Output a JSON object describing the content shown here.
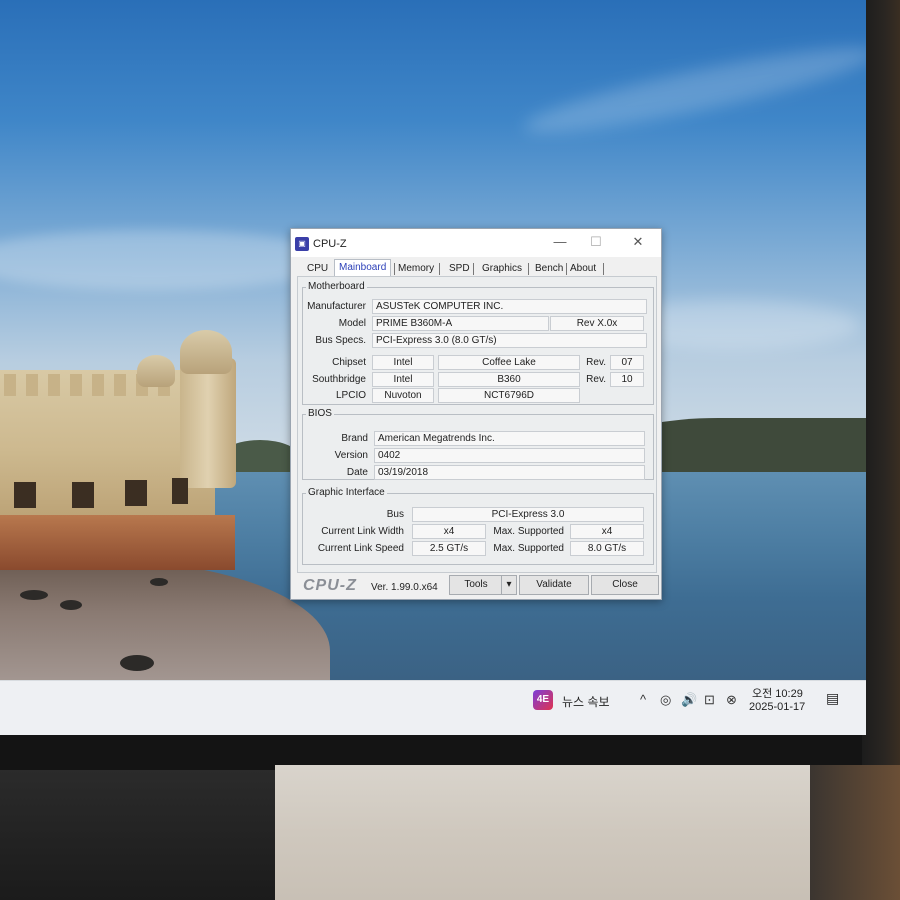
{
  "window": {
    "title": "CPU-Z",
    "app_icon": "cpuz-icon",
    "minimize": "—",
    "maximize": "☐",
    "close": "✕"
  },
  "tabs": [
    "CPU",
    "Mainboard",
    "Memory",
    "SPD",
    "Graphics",
    "Bench",
    "About"
  ],
  "active_tab": "Mainboard",
  "motherboard": {
    "title": "Motherboard",
    "manufacturer_label": "Manufacturer",
    "manufacturer": "ASUSTeK COMPUTER INC.",
    "model_label": "Model",
    "model": "PRIME B360M-A",
    "model_rev": "Rev X.0x",
    "bus_label": "Bus Specs.",
    "bus": "PCI-Express 3.0 (8.0 GT/s)",
    "chipset_label": "Chipset",
    "chipset_vendor": "Intel",
    "chipset_name": "Coffee Lake",
    "chipset_rev_label": "Rev.",
    "chipset_rev": "07",
    "southbridge_label": "Southbridge",
    "southbridge_vendor": "Intel",
    "southbridge_name": "B360",
    "southbridge_rev_label": "Rev.",
    "southbridge_rev": "10",
    "lpcio_label": "LPCIO",
    "lpcio_vendor": "Nuvoton",
    "lpcio_name": "NCT6796D"
  },
  "bios": {
    "title": "BIOS",
    "brand_label": "Brand",
    "brand": "American Megatrends Inc.",
    "version_label": "Version",
    "version": "0402",
    "date_label": "Date",
    "date": "03/19/2018"
  },
  "graphic_interface": {
    "title": "Graphic Interface",
    "bus_label": "Bus",
    "bus": "PCI-Express 3.0",
    "link_width_label": "Current Link Width",
    "link_width": "x4",
    "max_width_label": "Max. Supported",
    "max_width": "x4",
    "link_speed_label": "Current Link Speed",
    "link_speed": "2.5 GT/s",
    "max_speed_label": "Max. Supported",
    "max_speed": "8.0 GT/s"
  },
  "footer": {
    "logo": "CPU-Z",
    "version": "Ver. 1.99.0.x64",
    "tools": "Tools",
    "tools_arrow": "▾",
    "validate": "Validate",
    "close": "Close"
  },
  "taskbar": {
    "news_icon_text": "4E",
    "news_label": "뉴스 속보",
    "tray_icons": [
      "chevron-up-icon",
      "meet-now-icon",
      "volume-icon",
      "network-icon",
      "close-circle-icon"
    ],
    "tray_glyphs": [
      "^",
      "◎",
      "🔊",
      "⊡",
      "⊗"
    ],
    "time": "오전 10:29",
    "date": "2025-01-17",
    "notification_icon": "notification-icon"
  }
}
